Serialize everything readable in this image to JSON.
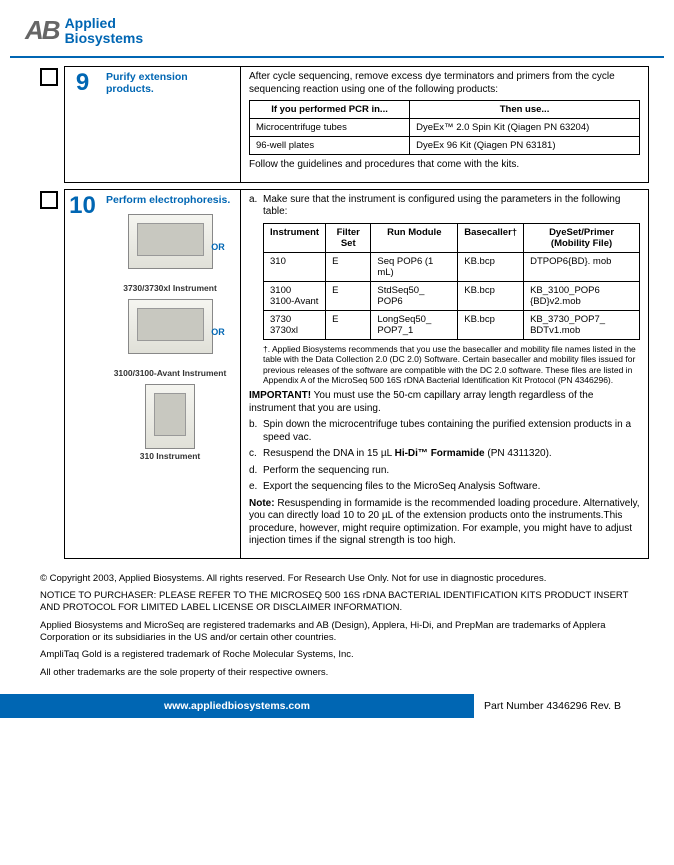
{
  "logo": {
    "mark": "AB",
    "line1": "Applied",
    "line2": "Biosystems"
  },
  "step9": {
    "num": "9",
    "title": "Purify extension products.",
    "intro": "After cycle sequencing, remove excess dye terminators and primers from the cycle sequencing reaction using one of the following products:",
    "table": {
      "h1": "If you performed PCR in...",
      "h2": "Then use...",
      "r1c1": "Microcentrifuge tubes",
      "r1c2": "DyeEx™ 2.0 Spin Kit (Qiagen PN 63204)",
      "r2c1": "96-well plates",
      "r2c2": "DyeEx 96 Kit (Qiagen PN 63181)"
    },
    "outro": "Follow the guidelines and procedures that come with the kits."
  },
  "step10": {
    "num": "10",
    "title": "Perform electrophoresis.",
    "img1_caption": "3730/3730xl Instrument",
    "img2_caption": "3100/3100-Avant Instrument",
    "img3_caption": "310 Instrument",
    "or": "OR",
    "a": "Make sure that the instrument is  configured using the parameters in the following table:",
    "table": {
      "h_instrument": "Instrument",
      "h_filter": "Filter Set",
      "h_run": "Run Module",
      "h_base": "Basecaller†",
      "h_dye": "DyeSet/Primer (Mobility File)",
      "r1": {
        "inst": "310",
        "filter": "E",
        "run": "Seq POP6 (1 mL)",
        "base": "KB.bcp",
        "dye": "DTPOP6{BD}. mob"
      },
      "r2": {
        "inst": "3100\n3100-Avant",
        "filter": "E",
        "run": "StdSeq50_ POP6",
        "base": "KB.bcp",
        "dye": "KB_3100_POP6 {BD}v2.mob"
      },
      "r3": {
        "inst": "3730\n3730xl",
        "filter": "E",
        "run": "LongSeq50_ POP7_1",
        "base": "KB.bcp",
        "dye": "KB_3730_POP7_ BDTv1.mob"
      }
    },
    "dagger": "†. Applied Biosystems recommends that you use the basecaller and mobility file names listed in the table with the Data Collection 2.0 (DC 2.0) Software. Certain basecaller and mobility files issued for previous releases of the software are compatible with the DC 2.0 software. These files are listed in Appendix A of the MicroSeq 500 16S rDNA Bacterial Identification Kit Protocol (PN 4346296).",
    "important_label": "IMPORTANT!",
    "important": " You must use the 50-cm capillary array length regardless of the instrument that you are using.",
    "b": "Spin down the microcentrifuge tubes containing the purified extension products in a speed vac.",
    "c_pre": "Resuspend the DNA in 15 µL ",
    "c_bold": "Hi-Di™ Formamide",
    "c_post": " (PN 4311320).",
    "d": "Perform the sequencing run.",
    "e": "Export the sequencing files to the MicroSeq Analysis Software.",
    "note_label": "Note:",
    "note": " Resuspending in formamide is the recommended loading procedure. Alternatively, you can directly load 10 to 20 µL of the extension products onto the instruments.This procedure, however, might require optimization. For example, you might have to adjust injection times if the signal strength is too high."
  },
  "legal": {
    "p1": "© Copyright 2003, Applied Biosystems. All rights reserved. For Research Use Only. Not for use in diagnostic procedures.",
    "p2": "NOTICE TO PURCHASER: PLEASE REFER TO THE MICROSEQ 500 16S rDNA BACTERIAL IDENTIFICATION KITS PRODUCT INSERT AND PROTOCOL FOR LIMITED LABEL LICENSE OR DISCLAIMER INFORMATION.",
    "p3": "Applied Biosystems and MicroSeq are registered trademarks and AB (Design), Applera, Hi-Di, and PrepMan are trademarks of Applera Corporation or its subsidiaries in the US and/or certain other countries.",
    "p4": "AmpliTaq Gold is a registered trademark of Roche Molecular Systems, Inc.",
    "p5": "All other trademarks are the sole property of their respective owners."
  },
  "footer": {
    "url": "www.appliedbiosystems.com",
    "part": "Part Number  4346296 Rev. B"
  }
}
